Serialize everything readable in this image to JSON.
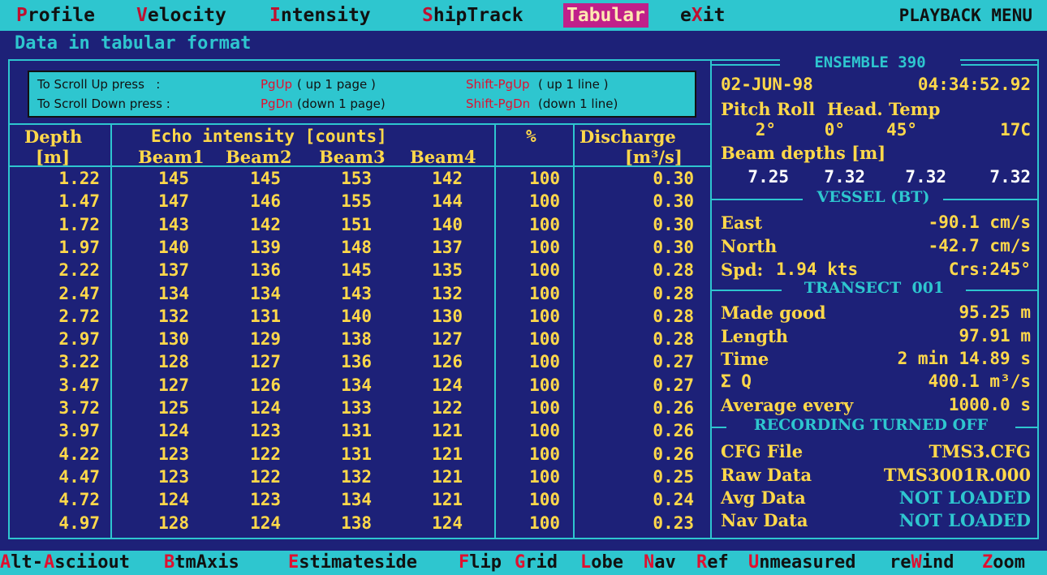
{
  "menu": {
    "items": [
      {
        "hot": "P",
        "rest": "rofile"
      },
      {
        "hot": "V",
        "rest": "elocity"
      },
      {
        "hot": "I",
        "rest": "ntensity"
      },
      {
        "hot": "S",
        "rest": "hipTrack"
      },
      {
        "hot": "T",
        "rest": "abular"
      },
      {
        "pre": "e",
        "hot": "X",
        "rest": "it"
      }
    ],
    "title": "PLAYBACK MENU"
  },
  "subtitle": "Data in tabular format",
  "help": {
    "up_label": "To Scroll Up press   :",
    "up_key": "PgUp",
    "up_desc": "( up 1 page )",
    "up_shift_key": "Shift-PgUp",
    "up_shift_desc": "( up 1 line )",
    "down_label": "To Scroll Down press :",
    "down_key": "PgDn",
    "down_desc": "(down 1 page)",
    "down_shift_key": "Shift-PgDn",
    "down_shift_desc": "(down 1 line)"
  },
  "table": {
    "depth_header": "Depth",
    "depth_unit": "[m]",
    "echo_header": "Echo intensity [counts]",
    "beams": [
      "Beam1",
      "Beam2",
      "Beam3",
      "Beam4"
    ],
    "pct_header": "%",
    "discharge_header": "Discharge",
    "discharge_unit": "[m³/s]",
    "rows": [
      [
        "1.22",
        "145",
        "145",
        "153",
        "142",
        "100",
        "0.30"
      ],
      [
        "1.47",
        "147",
        "146",
        "155",
        "144",
        "100",
        "0.30"
      ],
      [
        "1.72",
        "143",
        "142",
        "151",
        "140",
        "100",
        "0.30"
      ],
      [
        "1.97",
        "140",
        "139",
        "148",
        "137",
        "100",
        "0.30"
      ],
      [
        "2.22",
        "137",
        "136",
        "145",
        "135",
        "100",
        "0.28"
      ],
      [
        "2.47",
        "134",
        "134",
        "143",
        "132",
        "100",
        "0.28"
      ],
      [
        "2.72",
        "132",
        "131",
        "140",
        "130",
        "100",
        "0.28"
      ],
      [
        "2.97",
        "130",
        "129",
        "138",
        "127",
        "100",
        "0.28"
      ],
      [
        "3.22",
        "128",
        "127",
        "136",
        "126",
        "100",
        "0.27"
      ],
      [
        "3.47",
        "127",
        "126",
        "134",
        "124",
        "100",
        "0.27"
      ],
      [
        "3.72",
        "125",
        "124",
        "133",
        "122",
        "100",
        "0.26"
      ],
      [
        "3.97",
        "124",
        "123",
        "131",
        "121",
        "100",
        "0.26"
      ],
      [
        "4.22",
        "123",
        "122",
        "131",
        "121",
        "100",
        "0.26"
      ],
      [
        "4.47",
        "123",
        "122",
        "132",
        "121",
        "100",
        "0.25"
      ],
      [
        "4.72",
        "124",
        "123",
        "134",
        "121",
        "100",
        "0.24"
      ],
      [
        "4.97",
        "128",
        "124",
        "138",
        "124",
        "100",
        "0.23"
      ]
    ]
  },
  "ensemble": {
    "title": "ENSEMBLE 390",
    "date": "02-JUN-98",
    "time": "04:34:52.92",
    "att_header": "Pitch Roll  Head. Temp",
    "pitch": "2°",
    "roll": "0°",
    "head": "45°",
    "temp": "17C",
    "beam_depths_label": "Beam depths [m]",
    "beam_depths": [
      "7.25",
      "7.32",
      "7.32",
      "7.32"
    ]
  },
  "vessel": {
    "title": "VESSEL (BT)",
    "east_label": "East",
    "east_value": "-90.1 cm/s",
    "north_label": "North",
    "north_value": "-42.7 cm/s",
    "spd_label": "Spd:",
    "spd_value": "1.94 kts",
    "crs": "Crs:245°"
  },
  "transect": {
    "title": "TRANSECT  001",
    "made_good_label": "Made good",
    "made_good_value": "95.25 m",
    "length_label": "Length",
    "length_value": "97.91 m",
    "time_label": "Time",
    "time_value": "2 min 14.89 s",
    "q_label": "Σ Q",
    "q_value": "400.1 m³/s",
    "avg_label": "Average every",
    "avg_value": "1000.0 s"
  },
  "recording": {
    "title": "RECORDING TURNED OFF",
    "cfg_label": "CFG File",
    "cfg_value": "TMS3.CFG",
    "raw_label": "Raw Data",
    "raw_value": "TMS3001R.000",
    "avg_label": "Avg Data",
    "avg_value": "NOT LOADED",
    "nav_label": "Nav Data",
    "nav_value": "NOT LOADED"
  },
  "bottom": {
    "items": [
      {
        "hot": "A",
        "rest": "lt-"
      },
      {
        "hot": "A",
        "rest": "sciiout"
      },
      {
        "hot": "B",
        "rest": "tmAxis"
      },
      {
        "hot": "E",
        "rest": "stimateside"
      },
      {
        "hot": "F",
        "rest": "lip"
      },
      {
        "hot": "G",
        "rest": "rid"
      },
      {
        "hot": "L",
        "rest": "obe"
      },
      {
        "hot": "N",
        "rest": "av"
      },
      {
        "hot": "R",
        "rest": "ef"
      },
      {
        "hot": "U",
        "rest": "nmeasured"
      },
      {
        "pre": "re",
        "hot": "W",
        "rest": "ind"
      },
      {
        "hot": "Z",
        "rest": "oom"
      }
    ]
  }
}
